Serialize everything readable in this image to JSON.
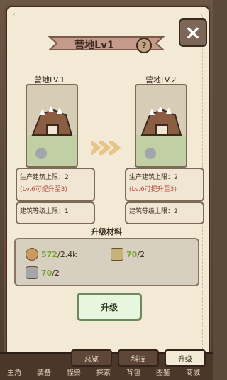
{
  "title": "营地Lv1",
  "left": {
    "label": "营地LV.1",
    "stat1": "生产建筑上限：2",
    "stat1_note": "(Lv.6可提升至3)",
    "stat2": "建筑等级上限：1"
  },
  "right": {
    "label": "营地LV.2",
    "stat1": "生产建筑上限：2",
    "stat1_note": "(Lv.6可提升至3)",
    "stat2": "建筑等级上限：2"
  },
  "materials": {
    "title": "升级材料",
    "items": [
      {
        "name": "resource1",
        "have": "572",
        "need": "2.4k"
      },
      {
        "name": "resource2",
        "have": "70",
        "need": "2"
      },
      {
        "name": "resource3",
        "have": "70",
        "need": "2"
      }
    ]
  },
  "upgrade_button": "升级",
  "tabs": [
    "总览",
    "科技",
    "升级"
  ],
  "active_tab": "升级",
  "bottom_nav": [
    "主角",
    "装备",
    "怪兽",
    "探索",
    "背包",
    "图鉴",
    "商城"
  ]
}
